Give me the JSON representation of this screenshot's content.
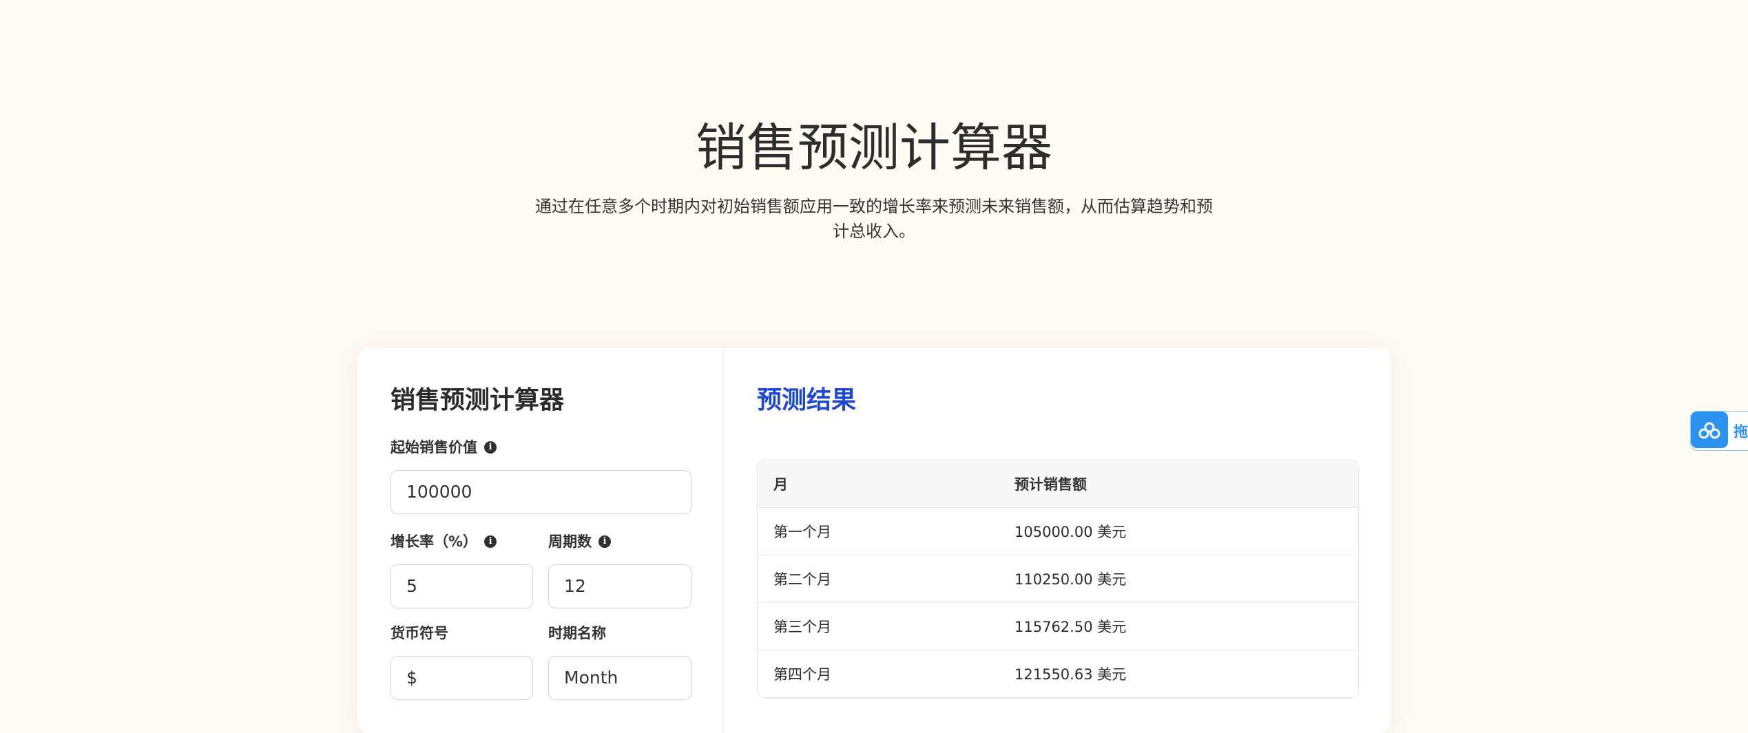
{
  "hero": {
    "title": "销售预测计算器",
    "description": "通过在任意多个时期内对初始销售额应用一致的增长率来预测未来销售额，从而估算趋势和预计总收入。"
  },
  "form": {
    "heading": "销售预测计算器",
    "start_value_label": "起始销售价值",
    "start_value": "100000",
    "growth_rate_label": "增长率（%）",
    "growth_rate": "5",
    "periods_label": "周期数",
    "periods": "12",
    "currency_label": "货币符号",
    "currency": "$",
    "period_name_label": "时期名称",
    "period_name": "Month",
    "info_icon": "info-icon"
  },
  "results": {
    "heading": "预测结果",
    "columns": [
      "月",
      "预计销售额"
    ],
    "rows": [
      [
        "第一个月",
        "105000.00 美元"
      ],
      [
        "第二个月",
        "110250.00 美元"
      ],
      [
        "第三个月",
        "115762.50 美元"
      ],
      [
        "第四个月",
        "121550.63 美元"
      ]
    ]
  },
  "side_widget": {
    "label": "拖",
    "icon": "cloud-icon",
    "color": "#2a93f0"
  },
  "colors": {
    "background": "#fffbf3",
    "accent": "#1b46d6"
  }
}
